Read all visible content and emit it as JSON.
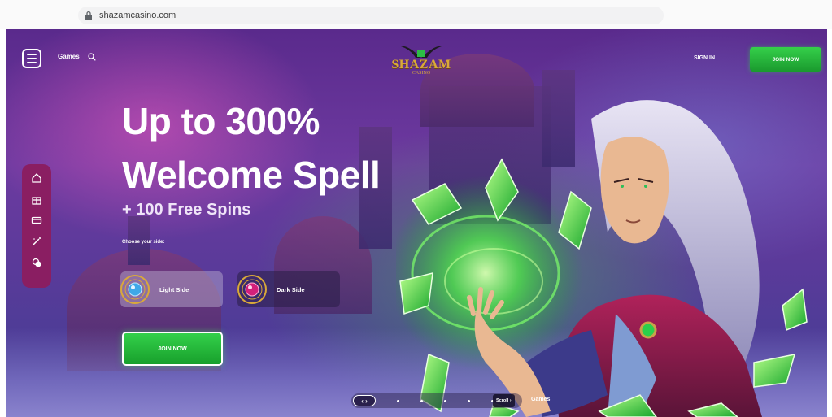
{
  "browser": {
    "url": "shazamcasino.com"
  },
  "header": {
    "games_label": "Games",
    "logo_text": "SHAZAM",
    "logo_sub": "CASINO",
    "sign_in_label": "SIGN IN",
    "join_label": "JOIN NOW"
  },
  "hero": {
    "headline_line1": "Up to 300%",
    "headline_line2": "Welcome Spell",
    "subhead": "+ 100 Free Spins",
    "choose_label": "Choose your side:",
    "light_side_label": "Light Side",
    "dark_side_label": "Dark Side",
    "join_label": "JOIN NOW"
  },
  "side_rail": {
    "icons": [
      "home-icon",
      "gift-icon",
      "cards-icon",
      "magic-wand-icon",
      "chips-icon"
    ]
  },
  "slider": {
    "arrows_label": "‹ ›",
    "scroll_label": "Scroll ›",
    "games_label": "Games"
  },
  "colors": {
    "accent_green": "#22b83a",
    "rail_magenta": "#8a1e62",
    "logo_gold": "#d9a93a"
  }
}
